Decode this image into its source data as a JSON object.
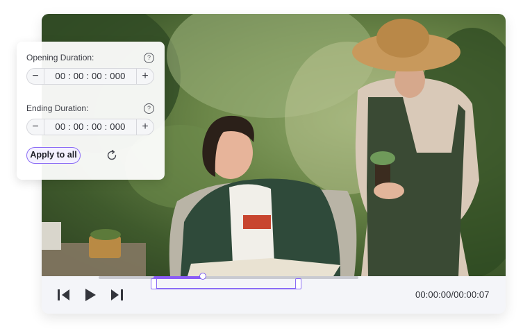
{
  "player": {
    "time_display": "00:00:00/00:00:07",
    "progress": 0.4,
    "trim_start": 0.21,
    "trim_end": 0.77
  },
  "panel": {
    "opening_label": "Opening Duration:",
    "opening_value": "00 : 00 : 00 : 000",
    "ending_label": "Ending Duration:",
    "ending_value": "00 : 00 : 00 : 000",
    "help_glyph": "?",
    "minus_glyph": "−",
    "plus_glyph": "+",
    "apply_label": "Apply to all"
  },
  "colors": {
    "accent": "#8b5cf6",
    "track": "#c9cad1",
    "controls_bg": "#f4f5f9"
  },
  "icons": [
    "previous-frame-icon",
    "play-icon",
    "next-frame-icon",
    "help-icon",
    "minus-icon",
    "plus-icon",
    "reset-icon"
  ]
}
